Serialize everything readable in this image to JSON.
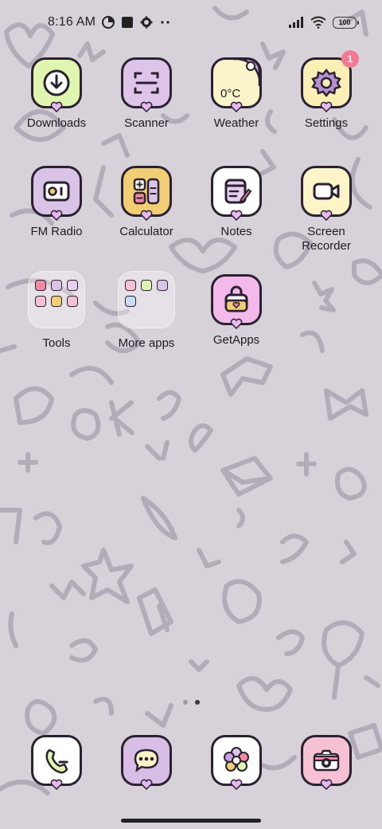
{
  "status_bar": {
    "time": "8:16 AM",
    "battery": "100",
    "icons": [
      "data-saver-icon",
      "stop-square-icon",
      "settings-gear-icon",
      "more-dots-icon",
      "signal-icon",
      "wifi-icon",
      "battery-icon"
    ]
  },
  "apps": {
    "downloads": {
      "label": "Downloads",
      "color": "#dff5b0"
    },
    "scanner": {
      "label": "Scanner",
      "color": "#ddc4e8"
    },
    "weather": {
      "label": "Weather",
      "color": "#fbf3c9",
      "temp": "0°C"
    },
    "settings": {
      "label": "Settings",
      "color": "#fcefb6",
      "badge": "1"
    },
    "fm_radio": {
      "label": "FM Radio",
      "color": "#d9c3e6"
    },
    "calculator": {
      "label": "Calculator",
      "color": "#f1cd73"
    },
    "notes": {
      "label": "Notes",
      "color": "#ffffff"
    },
    "screen_recorder": {
      "label": "Screen Recorder",
      "color": "#fdf4c7"
    },
    "tools": {
      "label": "Tools"
    },
    "more_apps": {
      "label": "More apps"
    },
    "getapps": {
      "label": "GetApps",
      "color": "#f2b9ea"
    }
  },
  "dock": {
    "phone": {
      "name": "phone-icon",
      "color": "#ffffff"
    },
    "messages": {
      "name": "messages-icon",
      "color": "#d8bde6"
    },
    "gallery": {
      "name": "gallery-flower-icon",
      "color": "#ffffff"
    },
    "camera": {
      "name": "camera-icon",
      "color": "#f7c1d4"
    }
  },
  "pagination": {
    "pages": 2,
    "active": 2
  },
  "accent": "#b06ac8"
}
